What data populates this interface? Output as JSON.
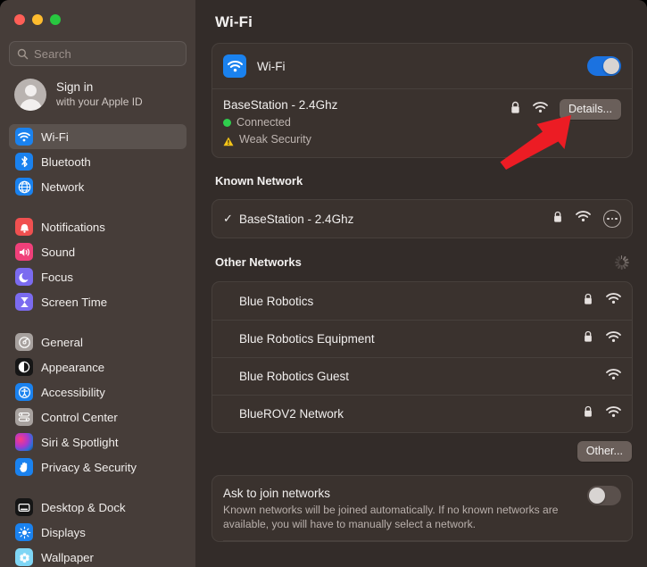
{
  "window": {
    "traffic_lights": [
      "close",
      "minimize",
      "zoom"
    ],
    "colors": {
      "accent_blue": "#1a82ef",
      "toggle_on": "#1b72e0",
      "connected_green": "#2fce4d",
      "warning_yellow": "#f5c518",
      "annotation_red": "#ec1c24",
      "sidebar_bg": "#463d39",
      "content_bg": "#332c29",
      "card_bg": "#3a322e"
    }
  },
  "sidebar": {
    "search": {
      "placeholder": "Search",
      "value": "",
      "icon": "search-icon"
    },
    "account": {
      "title": "Sign in",
      "subtitle": "with your Apple ID",
      "icon": "avatar"
    },
    "groups": [
      {
        "items": [
          {
            "label": "Wi-Fi",
            "icon": "wifi-icon",
            "selected": true
          },
          {
            "label": "Bluetooth",
            "icon": "bluetooth-icon",
            "selected": false
          },
          {
            "label": "Network",
            "icon": "globe-icon",
            "selected": false
          }
        ]
      },
      {
        "items": [
          {
            "label": "Notifications",
            "icon": "bell-icon",
            "selected": false
          },
          {
            "label": "Sound",
            "icon": "speaker-icon",
            "selected": false
          },
          {
            "label": "Focus",
            "icon": "moon-icon",
            "selected": false
          },
          {
            "label": "Screen Time",
            "icon": "hourglass-icon",
            "selected": false
          }
        ]
      },
      {
        "items": [
          {
            "label": "General",
            "icon": "gear-icon",
            "selected": false
          },
          {
            "label": "Appearance",
            "icon": "appearance-icon",
            "selected": false
          },
          {
            "label": "Accessibility",
            "icon": "accessibility-icon",
            "selected": false
          },
          {
            "label": "Control Center",
            "icon": "control-center-icon",
            "selected": false
          },
          {
            "label": "Siri & Spotlight",
            "icon": "siri-icon",
            "selected": false
          },
          {
            "label": "Privacy & Security",
            "icon": "hand-icon",
            "selected": false
          }
        ]
      },
      {
        "items": [
          {
            "label": "Desktop & Dock",
            "icon": "desktop-icon",
            "selected": false
          },
          {
            "label": "Displays",
            "icon": "brightness-icon",
            "selected": false
          },
          {
            "label": "Wallpaper",
            "icon": "wallpaper-icon",
            "selected": false
          }
        ]
      }
    ]
  },
  "main": {
    "title": "Wi-Fi",
    "wifi_master": {
      "label": "Wi-Fi",
      "icon": "wifi-icon",
      "toggle_state": "on"
    },
    "connected_network": {
      "name": "BaseStation - 2.4Ghz",
      "status": "Connected",
      "security_warning": "Weak Security",
      "lock_icon": "lock-icon",
      "signal_icon": "wifi-signal-icon",
      "details_button": "Details..."
    },
    "known_network": {
      "heading": "Known Network",
      "items": [
        {
          "name": "BaseStation - 2.4Ghz",
          "checked": true,
          "secured": true,
          "signal_icon": "wifi-signal-icon",
          "more_icon": "more-options-icon"
        }
      ]
    },
    "other_networks": {
      "heading": "Other Networks",
      "loading_icon": "spinner-icon",
      "items": [
        {
          "name": "Blue Robotics",
          "secured": true,
          "signal_icon": "wifi-signal-icon"
        },
        {
          "name": "Blue Robotics Equipment",
          "secured": true,
          "signal_icon": "wifi-signal-icon"
        },
        {
          "name": "Blue Robotics Guest",
          "secured": false,
          "signal_icon": "wifi-signal-icon"
        },
        {
          "name": "BlueROV2 Network",
          "secured": true,
          "signal_icon": "wifi-signal-icon"
        }
      ],
      "other_button": "Other..."
    },
    "ask_to_join": {
      "title": "Ask to join networks",
      "description": "Known networks will be joined automatically. If no known networks are available, you will have to manually select a network.",
      "toggle_state": "off"
    }
  },
  "annotation": {
    "arrow": {
      "type": "red-arrow",
      "points_to": "Details..."
    }
  }
}
